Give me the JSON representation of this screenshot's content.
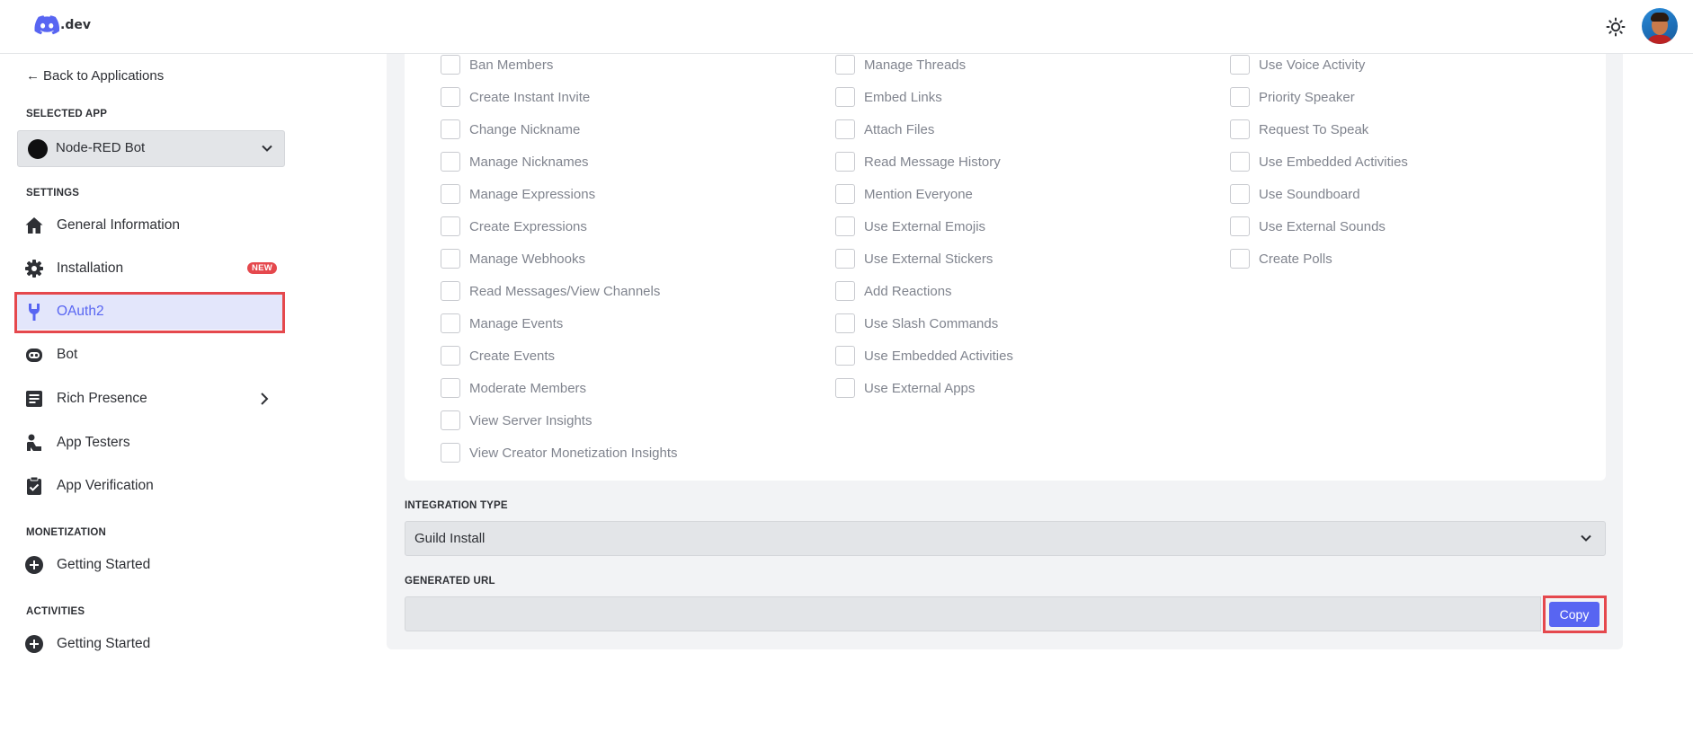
{
  "topbar": {
    "logo_text": ".dev",
    "logo_icon": "discord-icon",
    "theme_icon": "sun-icon",
    "avatar_icon": "user-avatar"
  },
  "sidebar": {
    "back_label": "Back to Applications",
    "selected_app_title": "SELECTED APP",
    "selected_app": "Node-RED Bot",
    "settings_title": "SETTINGS",
    "items": [
      {
        "label": "General Information",
        "icon": "home-icon"
      },
      {
        "label": "Installation",
        "icon": "gear-icon",
        "badge": "NEW"
      },
      {
        "label": "OAuth2",
        "icon": "wrench-icon",
        "active": true
      },
      {
        "label": "Bot",
        "icon": "robot-icon"
      },
      {
        "label": "Rich Presence",
        "icon": "document-icon"
      },
      {
        "label": "App Testers",
        "icon": "person-icon"
      },
      {
        "label": "App Verification",
        "icon": "clipboard-check-icon"
      }
    ],
    "monetization_title": "MONETIZATION",
    "monetization_item": "Getting Started",
    "activities_title": "ACTIVITIES",
    "activities_item": "Getting Started"
  },
  "permissions": {
    "col1": [
      "Ban Members",
      "Create Instant Invite",
      "Change Nickname",
      "Manage Nicknames",
      "Manage Expressions",
      "Create Expressions",
      "Manage Webhooks",
      "Read Messages/View Channels",
      "Manage Events",
      "Create Events",
      "Moderate Members",
      "View Server Insights",
      "View Creator Monetization Insights"
    ],
    "col2": [
      "Manage Threads",
      "Embed Links",
      "Attach Files",
      "Read Message History",
      "Mention Everyone",
      "Use External Emojis",
      "Use External Stickers",
      "Add Reactions",
      "Use Slash Commands",
      "Use Embedded Activities",
      "Use External Apps"
    ],
    "col3": [
      "Use Voice Activity",
      "Priority Speaker",
      "Request To Speak",
      "Use Embedded Activities",
      "Use Soundboard",
      "Use External Sounds",
      "Create Polls"
    ]
  },
  "integration": {
    "title": "INTEGRATION TYPE",
    "value": "Guild Install"
  },
  "generated_url": {
    "title": "GENERATED URL",
    "value": "",
    "copy_label": "Copy"
  },
  "colors": {
    "accent": "#5865f2",
    "highlight": "#e5484d",
    "active_bg": "#e3e6fb"
  }
}
